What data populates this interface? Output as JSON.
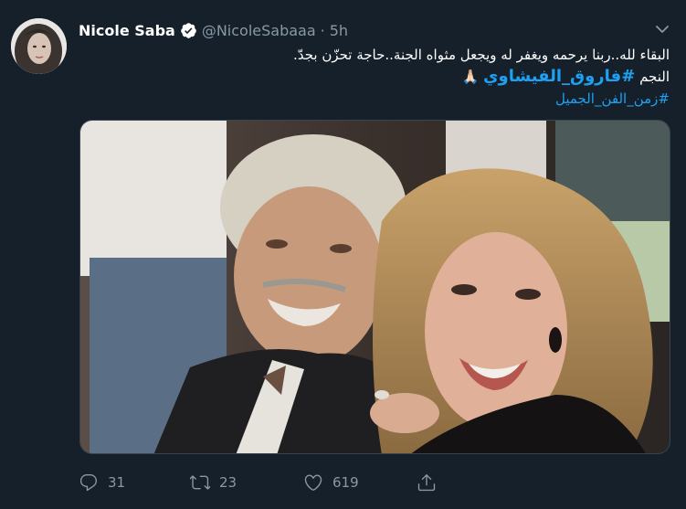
{
  "user": {
    "display_name": "Nicole Saba",
    "handle": "@NicoleSabaaa",
    "separator": "·",
    "time": "5h",
    "verified": true,
    "verified_color": "#ffffff"
  },
  "tweet": {
    "line1": "البقاء لله..ربنا يرحمه ويغفر له ويجعل مثواه الجنة..حاجة تحزّن بجدّ.",
    "line2_prefix": "النجم ",
    "line2_hashtag": "#فاروق_الفيشاوي",
    "line2_emoji": "🙏🏻",
    "line3_hashtag": "#زمن_الفن_الجميل"
  },
  "actions": {
    "reply_count": "31",
    "retweet_count": "23",
    "like_count": "619"
  },
  "icons": {
    "reply": "reply-icon",
    "retweet": "retweet-icon",
    "like": "heart-icon",
    "share": "share-icon",
    "caret": "chevron-down-icon",
    "verified": "verified-badge-icon"
  },
  "colors": {
    "background": "#15202b",
    "text": "#ffffff",
    "secondary": "#8899a6",
    "link": "#1da1f2",
    "border": "#38444d"
  }
}
